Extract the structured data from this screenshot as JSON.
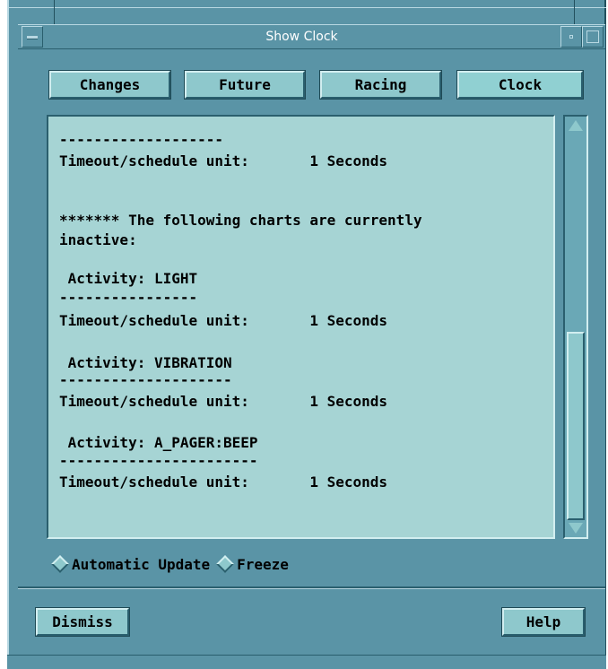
{
  "window": {
    "title": "Show Clock"
  },
  "tabs": [
    {
      "label": "Changes"
    },
    {
      "label": "Future"
    },
    {
      "label": "Racing"
    },
    {
      "label": "Clock",
      "active": true
    }
  ],
  "content": {
    "lines": [
      "-------------------",
      "Timeout/schedule unit:       1 Seconds",
      "******* The following charts are currently",
      "inactive:",
      " Activity: LIGHT",
      "----------------",
      "Timeout/schedule unit:       1 Seconds",
      " Activity: VIBRATION",
      "--------------------",
      "Timeout/schedule unit:       1 Seconds",
      " Activity: A_PAGER:BEEP",
      "-----------------------",
      "Timeout/schedule unit:       1 Seconds"
    ]
  },
  "update_mode": {
    "automatic_label": "Automatic Update",
    "freeze_label": "Freeze"
  },
  "buttons": {
    "dismiss": "Dismiss",
    "help": "Help"
  },
  "colors": {
    "frame": "#5a94a6",
    "text_area_bg": "#a6d4d4",
    "button_bg": "#8ec8cc"
  }
}
